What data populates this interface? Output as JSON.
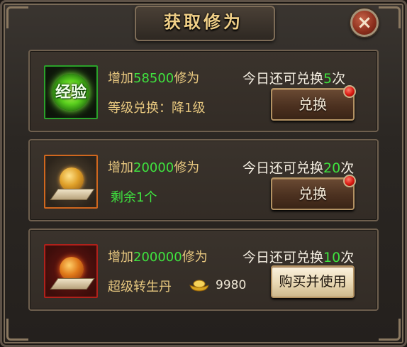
{
  "title": "获取修为",
  "close_glyph": "×",
  "rows": [
    {
      "prefix": "增加",
      "amount": "58500",
      "suffix": "修为",
      "detail": "等级兑换：降1级",
      "count_prefix": "今日还可兑换",
      "count_value": "5",
      "count_suffix": "次",
      "button": "兑换",
      "icon": "exp-badge-icon",
      "icon_text": "经验",
      "has_dot": true
    },
    {
      "prefix": "增加",
      "amount": "20000",
      "suffix": "修为",
      "detail": "剩余1个",
      "count_prefix": "今日还可兑换",
      "count_value": "20",
      "count_suffix": "次",
      "button": "兑换",
      "icon": "gold-orb-icon",
      "has_dot": true
    },
    {
      "prefix": "增加",
      "amount": "200000",
      "suffix": "修为",
      "detail": "超级转生丹",
      "price": "9980",
      "count_prefix": "今日还可兑换",
      "count_value": "10",
      "count_suffix": "次",
      "button": "购买并使用",
      "icon": "red-orb-icon",
      "has_dot": false
    }
  ],
  "colors": {
    "highlight_number": "#3fe43f",
    "gold_text": "#e7c77f",
    "frame": "#5e5247"
  }
}
